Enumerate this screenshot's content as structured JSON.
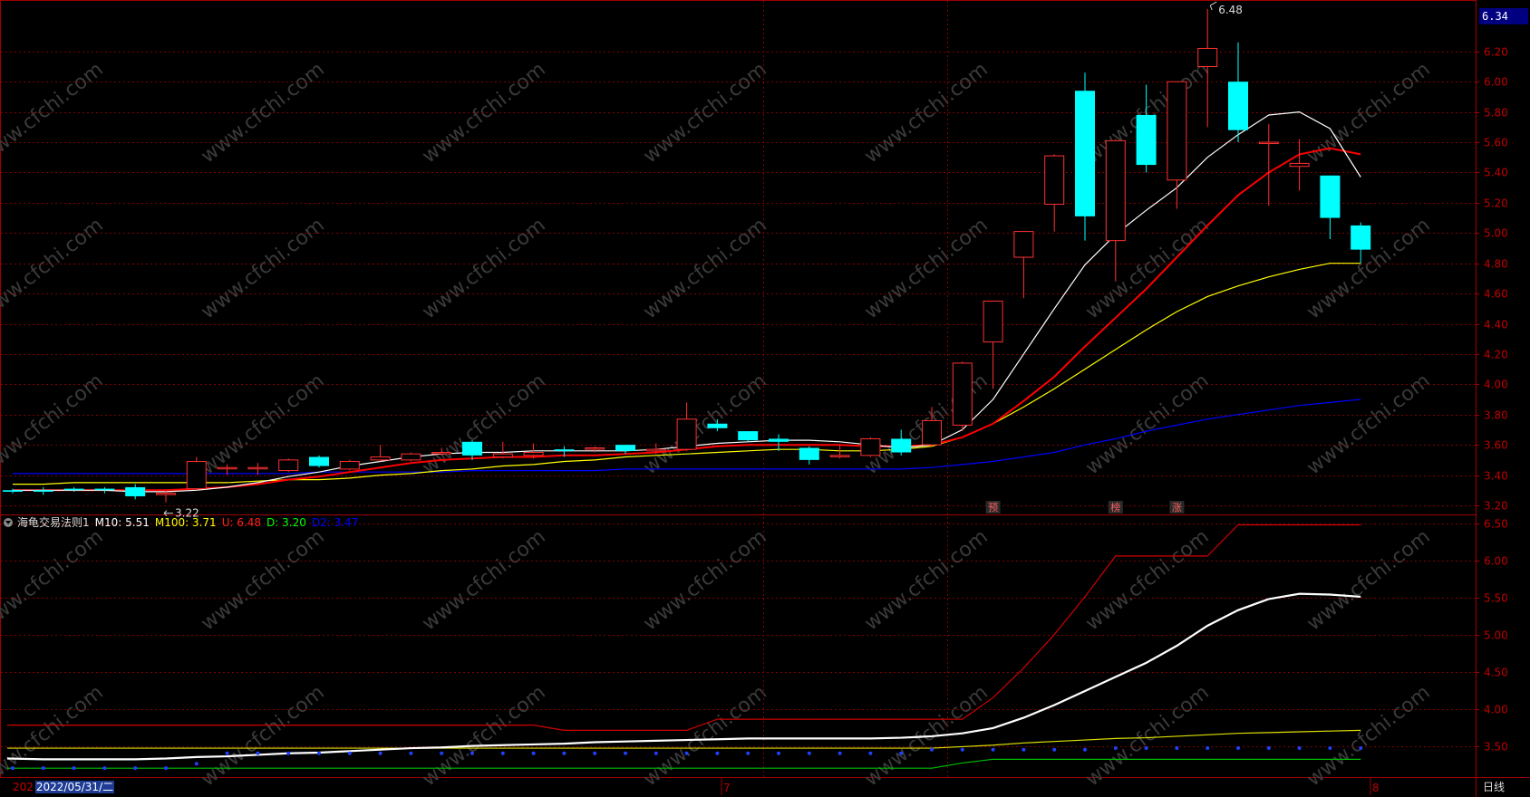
{
  "price_tag": "6.34",
  "high_label": "6.48",
  "low_label": "3.22",
  "main_axis": [
    "6.20",
    "6.00",
    "5.80",
    "5.60",
    "5.40",
    "5.20",
    "5.00",
    "4.80",
    "4.60",
    "4.40",
    "4.20",
    "4.00",
    "3.80",
    "3.60",
    "3.40",
    "3.20"
  ],
  "sub_axis": [
    "6.50",
    "6.00",
    "5.50",
    "5.00",
    "4.50",
    "4.00",
    "3.50"
  ],
  "markers": [
    "预",
    "榜",
    "涨"
  ],
  "indicator": {
    "name": "海龟交易法则1",
    "items": [
      {
        "label": "M10: 5.51",
        "color": "#ffffff"
      },
      {
        "label": "M100: 3.71",
        "color": "#ffff00"
      },
      {
        "label": "U: 6.48",
        "color": "#ff2020"
      },
      {
        "label": "D: 3.20",
        "color": "#00ff00"
      },
      {
        "label": "D2: 3.47",
        "color": "#0000ff"
      }
    ]
  },
  "x_axis": {
    "year_fragment": "202",
    "current_date": "2022/05/31/二",
    "month_labels": [
      "7",
      "8"
    ]
  },
  "period_label": "日线",
  "watermark": "www.cfchi.com",
  "colors": {
    "up": "#ff3030",
    "down": "#00ffff",
    "grid": "#800000",
    "ma_fast": "#ffffff",
    "ma_mid": "#ff0000",
    "ma_slow": "#ffff00",
    "ma_long": "#0000ff"
  },
  "chart_data": {
    "type": "candlestick",
    "y_range": [
      3.14,
      6.54
    ],
    "candles": [
      {
        "o": 3.3,
        "h": 3.31,
        "l": 3.28,
        "c": 3.29
      },
      {
        "o": 3.3,
        "h": 3.32,
        "l": 3.27,
        "c": 3.29
      },
      {
        "o": 3.31,
        "h": 3.32,
        "l": 3.29,
        "c": 3.3
      },
      {
        "o": 3.31,
        "h": 3.32,
        "l": 3.28,
        "c": 3.3
      },
      {
        "o": 3.32,
        "h": 3.34,
        "l": 3.24,
        "c": 3.26
      },
      {
        "o": 3.28,
        "h": 3.3,
        "l": 3.22,
        "c": 3.28
      },
      {
        "o": 3.31,
        "h": 3.52,
        "l": 3.3,
        "c": 3.49
      },
      {
        "o": 3.45,
        "h": 3.47,
        "l": 3.4,
        "c": 3.45
      },
      {
        "o": 3.45,
        "h": 3.48,
        "l": 3.4,
        "c": 3.45
      },
      {
        "o": 3.43,
        "h": 3.51,
        "l": 3.42,
        "c": 3.5
      },
      {
        "o": 3.52,
        "h": 3.53,
        "l": 3.45,
        "c": 3.46
      },
      {
        "o": 3.44,
        "h": 3.5,
        "l": 3.43,
        "c": 3.49
      },
      {
        "o": 3.5,
        "h": 3.6,
        "l": 3.49,
        "c": 3.52
      },
      {
        "o": 3.5,
        "h": 3.55,
        "l": 3.49,
        "c": 3.54
      },
      {
        "o": 3.55,
        "h": 3.58,
        "l": 3.53,
        "c": 3.55
      },
      {
        "o": 3.62,
        "h": 3.63,
        "l": 3.5,
        "c": 3.53
      },
      {
        "o": 3.52,
        "h": 3.62,
        "l": 3.51,
        "c": 3.54
      },
      {
        "o": 3.53,
        "h": 3.61,
        "l": 3.51,
        "c": 3.55
      },
      {
        "o": 3.57,
        "h": 3.59,
        "l": 3.52,
        "c": 3.56
      },
      {
        "o": 3.58,
        "h": 3.59,
        "l": 3.55,
        "c": 3.58
      },
      {
        "o": 3.6,
        "h": 3.6,
        "l": 3.54,
        "c": 3.56
      },
      {
        "o": 3.56,
        "h": 3.61,
        "l": 3.54,
        "c": 3.57
      },
      {
        "o": 3.57,
        "h": 3.88,
        "l": 3.56,
        "c": 3.77
      },
      {
        "o": 3.74,
        "h": 3.77,
        "l": 3.69,
        "c": 3.71
      },
      {
        "o": 3.69,
        "h": 3.69,
        "l": 3.62,
        "c": 3.63
      },
      {
        "o": 3.64,
        "h": 3.67,
        "l": 3.56,
        "c": 3.62
      },
      {
        "o": 3.58,
        "h": 3.59,
        "l": 3.47,
        "c": 3.5
      },
      {
        "o": 3.53,
        "h": 3.6,
        "l": 3.51,
        "c": 3.53
      },
      {
        "o": 3.53,
        "h": 3.65,
        "l": 3.52,
        "c": 3.64
      },
      {
        "o": 3.64,
        "h": 3.7,
        "l": 3.53,
        "c": 3.55
      },
      {
        "o": 3.6,
        "h": 3.85,
        "l": 3.59,
        "c": 3.76
      },
      {
        "o": 3.73,
        "h": 4.15,
        "l": 3.69,
        "c": 4.14
      },
      {
        "o": 4.28,
        "h": 4.55,
        "l": 3.97,
        "c": 4.55
      },
      {
        "o": 4.84,
        "h": 5.01,
        "l": 4.57,
        "c": 5.01
      },
      {
        "o": 5.19,
        "h": 5.52,
        "l": 5.01,
        "c": 5.51
      },
      {
        "o": 5.94,
        "h": 6.06,
        "l": 4.95,
        "c": 5.11
      },
      {
        "o": 4.95,
        "h": 5.62,
        "l": 4.68,
        "c": 5.61
      },
      {
        "o": 5.78,
        "h": 5.98,
        "l": 5.4,
        "c": 5.45
      },
      {
        "o": 5.35,
        "h": 6.0,
        "l": 5.16,
        "c": 6.0
      },
      {
        "o": 6.1,
        "h": 6.48,
        "l": 5.7,
        "c": 6.22
      },
      {
        "o": 6.0,
        "h": 6.26,
        "l": 5.6,
        "c": 5.68
      },
      {
        "o": 5.6,
        "h": 5.72,
        "l": 5.18,
        "c": 5.6
      },
      {
        "o": 5.44,
        "h": 5.62,
        "l": 5.28,
        "c": 5.46
      },
      {
        "o": 5.38,
        "h": 5.38,
        "l": 4.96,
        "c": 5.1
      },
      {
        "o": 5.05,
        "h": 5.07,
        "l": 4.8,
        "c": 4.89
      }
    ],
    "ma_fast": [
      3.3,
      3.3,
      3.3,
      3.3,
      3.29,
      3.29,
      3.3,
      3.32,
      3.35,
      3.39,
      3.42,
      3.46,
      3.49,
      3.52,
      3.54,
      3.55,
      3.55,
      3.56,
      3.56,
      3.56,
      3.56,
      3.57,
      3.59,
      3.61,
      3.62,
      3.63,
      3.63,
      3.62,
      3.6,
      3.58,
      3.6,
      3.7,
      3.9,
      4.2,
      4.5,
      4.79,
      4.99,
      5.15,
      5.3,
      5.5,
      5.65,
      5.78,
      5.8,
      5.69,
      5.37
    ],
    "ma_mid": [
      3.3,
      3.3,
      3.3,
      3.3,
      3.3,
      3.3,
      3.31,
      3.32,
      3.34,
      3.37,
      3.39,
      3.42,
      3.45,
      3.48,
      3.5,
      3.51,
      3.52,
      3.52,
      3.53,
      3.53,
      3.54,
      3.55,
      3.57,
      3.59,
      3.6,
      3.6,
      3.6,
      3.6,
      3.59,
      3.59,
      3.6,
      3.65,
      3.74,
      3.89,
      4.05,
      4.25,
      4.44,
      4.63,
      4.84,
      5.05,
      5.25,
      5.4,
      5.52,
      5.56,
      5.52
    ],
    "ma_slow": [
      3.34,
      3.34,
      3.35,
      3.35,
      3.35,
      3.35,
      3.35,
      3.35,
      3.36,
      3.37,
      3.37,
      3.38,
      3.4,
      3.41,
      3.43,
      3.44,
      3.46,
      3.47,
      3.49,
      3.5,
      3.52,
      3.53,
      3.54,
      3.55,
      3.56,
      3.57,
      3.57,
      3.56,
      3.56,
      3.57,
      3.59,
      3.65,
      3.74,
      3.85,
      3.97,
      4.1,
      4.23,
      4.36,
      4.48,
      4.58,
      4.65,
      4.71,
      4.76,
      4.8,
      4.8
    ],
    "ma_long": [
      3.41,
      3.41,
      3.41,
      3.41,
      3.41,
      3.41,
      3.41,
      3.41,
      3.41,
      3.41,
      3.42,
      3.42,
      3.42,
      3.42,
      3.42,
      3.43,
      3.43,
      3.43,
      3.43,
      3.43,
      3.44,
      3.44,
      3.44,
      3.44,
      3.44,
      3.44,
      3.44,
      3.44,
      3.44,
      3.44,
      3.45,
      3.47,
      3.49,
      3.52,
      3.55,
      3.6,
      3.64,
      3.69,
      3.73,
      3.77,
      3.8,
      3.83,
      3.86,
      3.88,
      3.9
    ],
    "sub_y_range": [
      3.08,
      6.62
    ],
    "sub_m10": [
      3.33,
      3.32,
      3.32,
      3.32,
      3.32,
      3.33,
      3.35,
      3.36,
      3.38,
      3.4,
      3.41,
      3.43,
      3.45,
      3.47,
      3.48,
      3.5,
      3.51,
      3.52,
      3.53,
      3.55,
      3.56,
      3.57,
      3.58,
      3.59,
      3.6,
      3.6,
      3.6,
      3.6,
      3.6,
      3.61,
      3.63,
      3.67,
      3.74,
      3.88,
      4.05,
      4.24,
      4.43,
      4.62,
      4.85,
      5.12,
      5.33,
      5.48,
      5.55,
      5.54,
      5.51
    ],
    "sub_m100": [
      3.47,
      3.47,
      3.47,
      3.47,
      3.47,
      3.47,
      3.47,
      3.47,
      3.47,
      3.47,
      3.47,
      3.47,
      3.47,
      3.47,
      3.47,
      3.47,
      3.47,
      3.47,
      3.47,
      3.47,
      3.47,
      3.47,
      3.47,
      3.47,
      3.47,
      3.47,
      3.47,
      3.47,
      3.47,
      3.47,
      3.47,
      3.49,
      3.51,
      3.54,
      3.56,
      3.58,
      3.6,
      3.61,
      3.63,
      3.65,
      3.67,
      3.68,
      3.69,
      3.7,
      3.71
    ],
    "sub_u": [
      3.78,
      3.78,
      3.78,
      3.78,
      3.78,
      3.78,
      3.78,
      3.78,
      3.78,
      3.78,
      3.78,
      3.78,
      3.78,
      3.78,
      3.78,
      3.78,
      3.78,
      3.78,
      3.71,
      3.71,
      3.71,
      3.71,
      3.71,
      3.86,
      3.86,
      3.86,
      3.86,
      3.86,
      3.86,
      3.86,
      3.86,
      3.86,
      4.15,
      4.55,
      5.0,
      5.51,
      6.06,
      6.06,
      6.06,
      6.06,
      6.48,
      6.48,
      6.48,
      6.48,
      6.48
    ],
    "sub_d": [
      3.2,
      3.2,
      3.2,
      3.2,
      3.2,
      3.2,
      3.2,
      3.2,
      3.2,
      3.2,
      3.2,
      3.2,
      3.2,
      3.2,
      3.2,
      3.2,
      3.2,
      3.2,
      3.2,
      3.2,
      3.2,
      3.2,
      3.2,
      3.2,
      3.2,
      3.2,
      3.2,
      3.2,
      3.2,
      3.2,
      3.2,
      3.27,
      3.32,
      3.32,
      3.32,
      3.32,
      3.32,
      3.32,
      3.32,
      3.32,
      3.32,
      3.32,
      3.32,
      3.32,
      3.32
    ],
    "sub_d2": [
      3.2,
      3.2,
      3.2,
      3.2,
      3.2,
      3.2,
      3.26,
      3.4,
      3.4,
      3.4,
      3.4,
      3.4,
      3.4,
      3.4,
      3.4,
      3.4,
      3.4,
      3.4,
      3.4,
      3.4,
      3.4,
      3.4,
      3.4,
      3.4,
      3.4,
      3.4,
      3.4,
      3.4,
      3.4,
      3.4,
      3.45,
      3.45,
      3.45,
      3.45,
      3.45,
      3.45,
      3.47,
      3.47,
      3.47,
      3.47,
      3.47,
      3.47,
      3.47,
      3.47,
      3.47
    ]
  }
}
